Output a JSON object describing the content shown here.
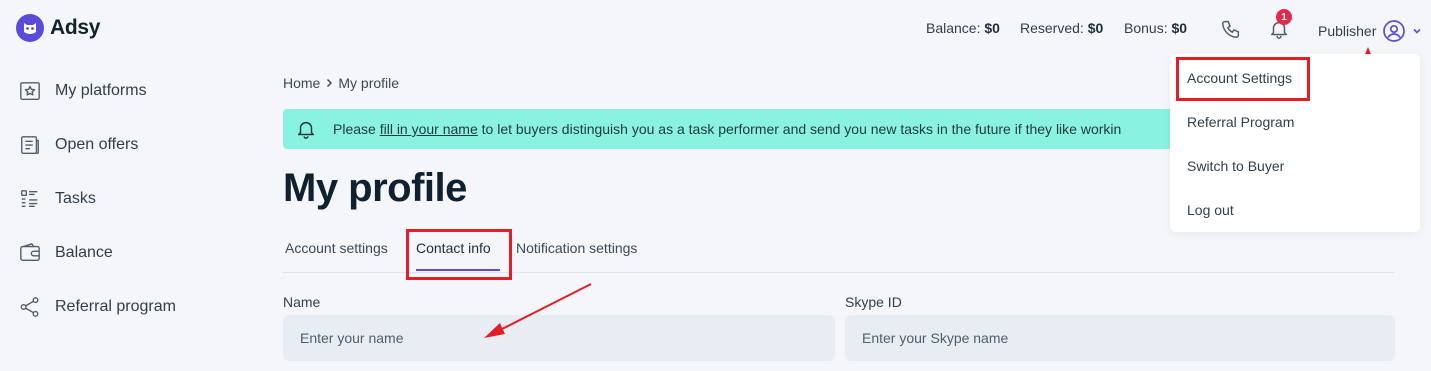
{
  "brand": {
    "name": "Adsy"
  },
  "header": {
    "balance_label": "Balance:",
    "balance_value": "$0",
    "reserved_label": "Reserved:",
    "reserved_value": "$0",
    "bonus_label": "Bonus:",
    "bonus_value": "$0",
    "notification_count": "1",
    "role": "Publisher"
  },
  "sidebar": {
    "items": [
      {
        "label": "My platforms",
        "icon": "star-frame-icon"
      },
      {
        "label": "Open offers",
        "icon": "document-icon"
      },
      {
        "label": "Tasks",
        "icon": "checklist-icon"
      },
      {
        "label": "Balance",
        "icon": "wallet-icon"
      },
      {
        "label": "Referral program",
        "icon": "share-icon"
      }
    ]
  },
  "breadcrumb": {
    "home": "Home",
    "current": "My profile"
  },
  "banner": {
    "prefix": "Please ",
    "link": "fill in your name",
    "suffix": " to let buyers distinguish you as a task performer and send you new tasks in the future if they like workin"
  },
  "page": {
    "title": "My profile"
  },
  "tabs": [
    {
      "label": "Account settings"
    },
    {
      "label": "Contact info",
      "active": true
    },
    {
      "label": "Notification settings"
    }
  ],
  "form": {
    "name_label": "Name",
    "name_placeholder": "Enter your name",
    "name_value": "",
    "skype_label": "Skype ID",
    "skype_placeholder": "Enter your Skype name",
    "skype_value": ""
  },
  "dropdown": {
    "items": [
      {
        "label": "Account Settings"
      },
      {
        "label": "Referral Program"
      },
      {
        "label": "Switch to Buyer"
      },
      {
        "label": "Log out"
      }
    ]
  },
  "colors": {
    "accent": "#5b4bdb",
    "banner": "#8af2e0",
    "highlight": "#e21e26",
    "badge": "#e5294d"
  }
}
